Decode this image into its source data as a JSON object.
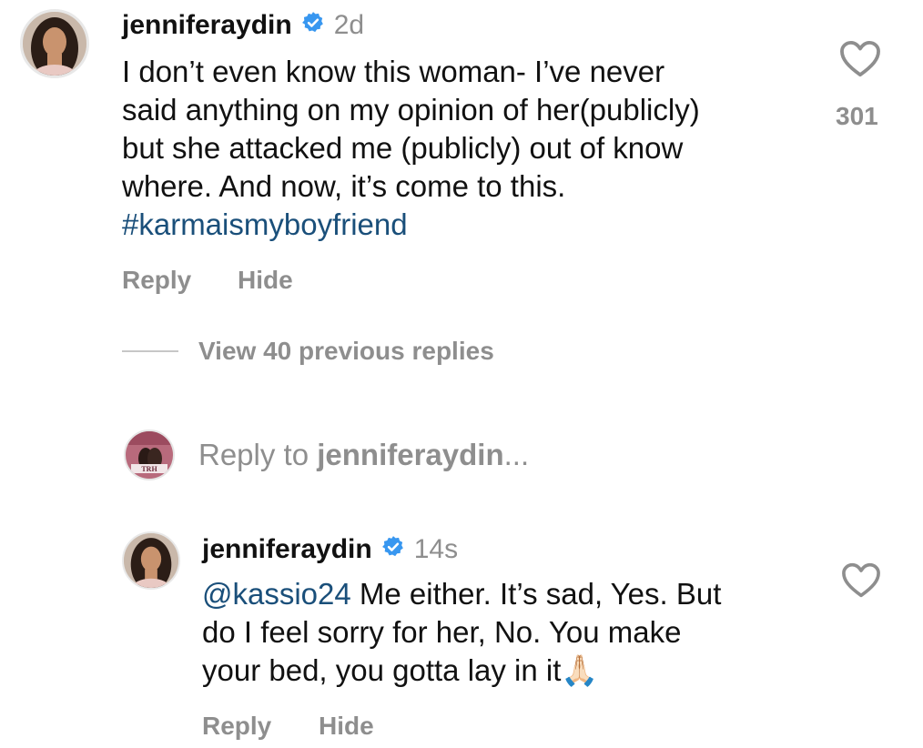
{
  "comment": {
    "username": "jenniferaydin",
    "time": "2d",
    "text_lines": [
      "I don’t even know this woman- I’ve never",
      "said anything on my opinion of her(publicly)",
      "but she attacked me (publicly) out of know",
      "where. And now, it’s come to this."
    ],
    "hashtag": "#karmaismyboyfriend",
    "like_count": "301",
    "reply_label": "Reply",
    "hide_label": "Hide"
  },
  "view_replies": {
    "label": "View 40 previous replies"
  },
  "reply_composer": {
    "prefix": "Reply to",
    "target": "jenniferaydin",
    "suffix": "..."
  },
  "reply": {
    "username": "jenniferaydin",
    "time": "14s",
    "mention": "@kassio24",
    "text_first": " Me either. It’s sad, Yes. But",
    "text_lines": [
      "do I feel sorry for her, No. You make",
      "your bed, you gotta lay in it"
    ],
    "emoji": "🙏🏻",
    "reply_label": "Reply",
    "hide_label": "Hide"
  },
  "icons": {
    "verified": "verified-badge-icon",
    "heart": "heart-outline-icon"
  },
  "colors": {
    "verified_blue": "#3897f0",
    "link_blue": "#1a4f7a",
    "muted_gray": "#8e8e8e"
  }
}
